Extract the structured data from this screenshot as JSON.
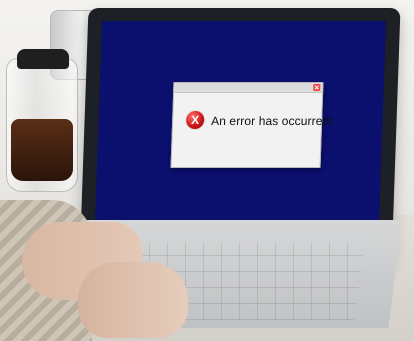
{
  "dialog": {
    "message": "An error has occurred!",
    "icon": "error-icon",
    "close_icon": "close-icon"
  },
  "colors": {
    "screen": "#0b0f6e",
    "error_red": "#c71414"
  }
}
